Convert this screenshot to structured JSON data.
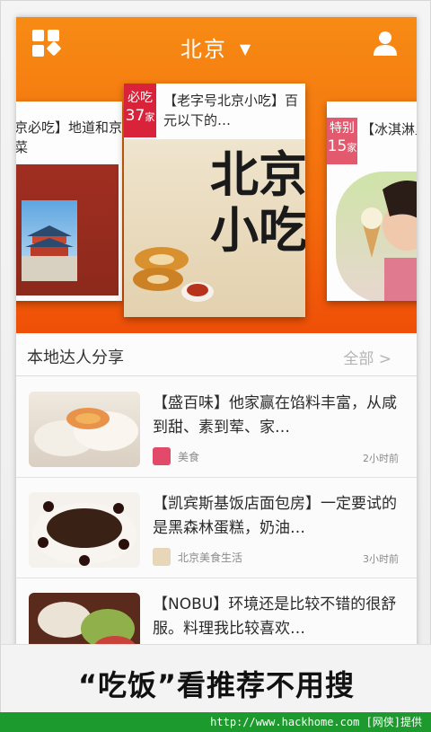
{
  "header": {
    "city": "北京",
    "city_arrow": "▼",
    "menu_icon": "grid-icon",
    "user_icon": "user-icon"
  },
  "cards": {
    "left": {
      "title": "京必吃】地道和京菜"
    },
    "center": {
      "badge_top": "必吃",
      "badge_num": "37",
      "badge_unit": "家",
      "title": "【老字号北京小吃】百元以下的…",
      "book_title": "北京小吃"
    },
    "right": {
      "badge_top": "特别",
      "badge_num": "15",
      "badge_unit": "家",
      "title": "【冰淇淋里有好吃"
    }
  },
  "share": {
    "title": "本地达人分享",
    "all": "全部 >",
    "items": [
      {
        "text": "【盛百味】他家赢在馅料丰富，从咸到甜、素到荤、家…",
        "source": "美食",
        "time": "2小时前"
      },
      {
        "text": "【凯宾斯基饭店面包房】一定要试的是黑森林蛋糕，奶油…",
        "source": "北京美食生活",
        "time": "3小时前"
      },
      {
        "text": "【NOBU】环境还是比较不错的很舒服。料理我比较喜欢…",
        "source": "",
        "time": ""
      }
    ]
  },
  "banner": {
    "text": "“吃饭”看推荐不用搜"
  },
  "footer": {
    "text": "http://www.hackhome.com [网侠]提供"
  },
  "colors": {
    "accent": "#f46c0c",
    "badge": "#d9233a",
    "footer": "#1d9a2e"
  }
}
